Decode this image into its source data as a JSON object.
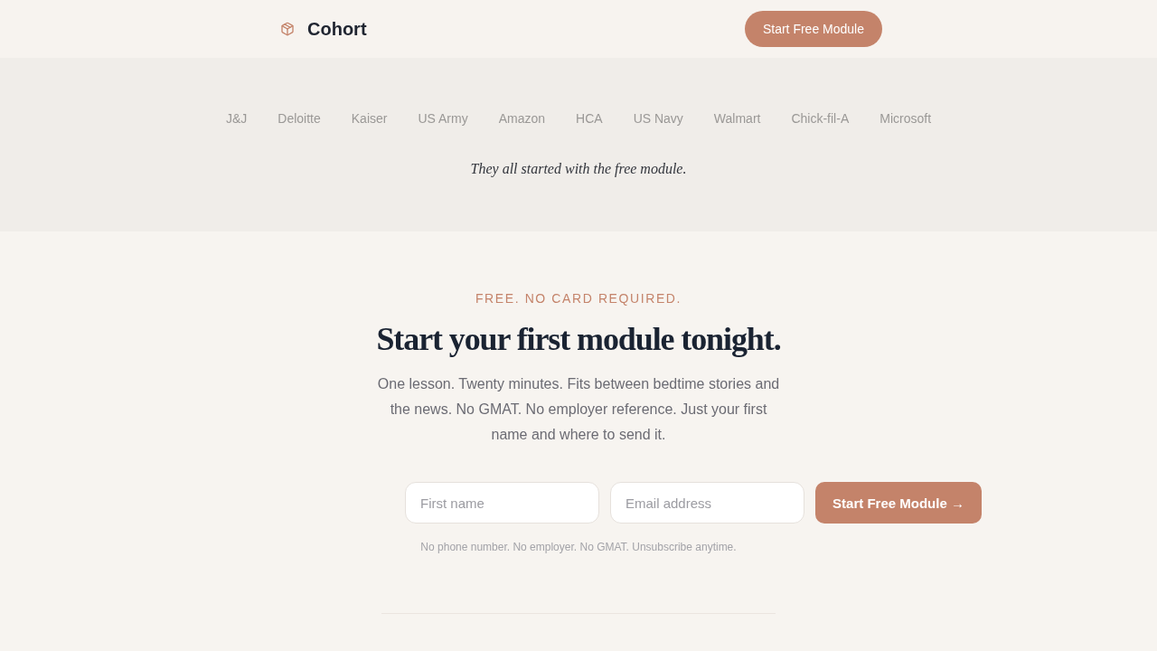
{
  "header": {
    "brand": "Cohort",
    "cta": "Start Free Module"
  },
  "logos": {
    "items": [
      "J&J",
      "Deloitte",
      "Kaiser",
      "US Army",
      "Amazon",
      "HCA",
      "US Navy",
      "Walmart",
      "Chick-fil-A",
      "Microsoft"
    ],
    "tagline": "They all started with the free module."
  },
  "signup": {
    "eyebrow": "FREE. NO CARD REQUIRED.",
    "heading": "Start your first module tonight.",
    "body": "One lesson. Twenty minutes. Fits between bedtime stories and the news. No GMAT. No employer reference. Just your first name and where to send it.",
    "fields": [
      {
        "placeholder": "First name"
      },
      {
        "placeholder": "Email address"
      }
    ],
    "submit": "Start Free Module →",
    "note": "No phone number. No employer. No GMAT. Unsubscribe anytime."
  }
}
